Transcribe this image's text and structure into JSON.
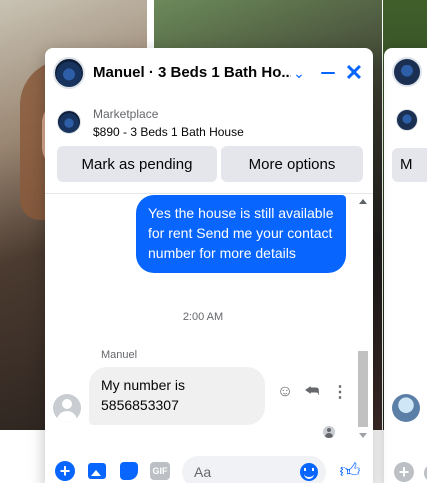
{
  "chat": {
    "title": "Manuel · 3 Beds 1 Bath Ho...",
    "listing": {
      "label": "Marketplace",
      "description": "$890 - 3 Beds 1 Bath House"
    },
    "buttons": {
      "pending": "Mark as pending",
      "more": "More options"
    },
    "messages": {
      "outgoing": "Yes the house is still available for rent Send me your contact number for more details",
      "timestamp": "2:00 AM",
      "sender": "Manuel",
      "incoming": "My number is 5856853307"
    },
    "composer": {
      "placeholder": "Aa",
      "gif": "GIF"
    }
  },
  "peek": {
    "button_initial": "M"
  },
  "colors": {
    "accent": "#0866ff",
    "bubble_in": "#f0f0f0",
    "button_bg": "#e4e6eb",
    "muted_text": "#65676b"
  },
  "icons": [
    "chevron-down-icon",
    "minimize-icon",
    "close-icon",
    "emoji-reaction-icon",
    "reply-icon",
    "more-icon",
    "plus-icon",
    "photo-icon",
    "sticker-icon",
    "gif-icon",
    "emoji-icon",
    "like-icon"
  ]
}
